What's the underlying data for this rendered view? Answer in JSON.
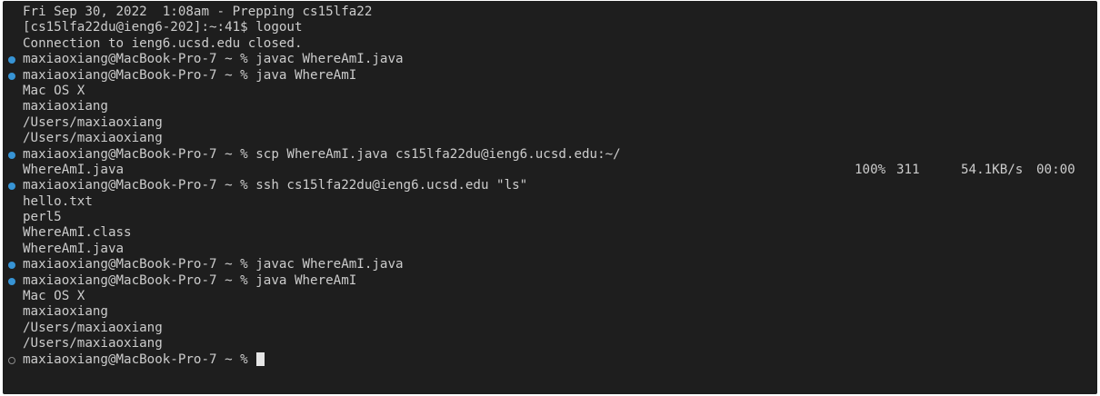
{
  "terminal": {
    "lines": [
      {
        "marker": "none",
        "text": "Fri Sep 30, 2022  1:08am - Prepping cs15lfa22"
      },
      {
        "marker": "none",
        "text": "[cs15lfa22du@ieng6-202]:~:41$ logout"
      },
      {
        "marker": "none",
        "text": "Connection to ieng6.ucsd.edu closed."
      },
      {
        "marker": "done",
        "text": "maxiaoxiang@MacBook-Pro-7 ~ % javac WhereAmI.java"
      },
      {
        "marker": "done",
        "text": "maxiaoxiang@MacBook-Pro-7 ~ % java WhereAmI"
      },
      {
        "marker": "none",
        "text": "Mac OS X"
      },
      {
        "marker": "none",
        "text": "maxiaoxiang"
      },
      {
        "marker": "none",
        "text": "/Users/maxiaoxiang"
      },
      {
        "marker": "none",
        "text": "/Users/maxiaoxiang"
      },
      {
        "marker": "done",
        "text": "maxiaoxiang@MacBook-Pro-7 ~ % scp WhereAmI.java cs15lfa22du@ieng6.ucsd.edu:~/"
      },
      {
        "marker": "none",
        "text": "WhereAmI.java"
      },
      {
        "marker": "done",
        "text": "maxiaoxiang@MacBook-Pro-7 ~ % ssh cs15lfa22du@ieng6.ucsd.edu \"ls\""
      },
      {
        "marker": "none",
        "text": "hello.txt"
      },
      {
        "marker": "none",
        "text": "perl5"
      },
      {
        "marker": "none",
        "text": "WhereAmI.class"
      },
      {
        "marker": "none",
        "text": "WhereAmI.java"
      },
      {
        "marker": "done",
        "text": "maxiaoxiang@MacBook-Pro-7 ~ % javac WhereAmI.java"
      },
      {
        "marker": "done",
        "text": "maxiaoxiang@MacBook-Pro-7 ~ % java WhereAmI"
      },
      {
        "marker": "none",
        "text": "Mac OS X"
      },
      {
        "marker": "none",
        "text": "maxiaoxiang"
      },
      {
        "marker": "none",
        "text": "/Users/maxiaoxiang"
      },
      {
        "marker": "none",
        "text": "/Users/maxiaoxiang"
      },
      {
        "marker": "pending",
        "text": "maxiaoxiang@MacBook-Pro-7 ~ % "
      }
    ],
    "transfer": {
      "percent": "100%",
      "size": "311",
      "rate": "54.1KB/s",
      "eta": "00:00"
    }
  },
  "colors": {
    "background": "#1e1e1e",
    "text": "#cccccc",
    "marker_done": "#3794d5",
    "marker_pending": "#8a8a8a",
    "cursor": "#e6e6e6"
  },
  "icons": {
    "marker_done": "filled-circle-icon",
    "marker_pending": "hollow-circle-icon",
    "cursor": "block-cursor-icon"
  }
}
